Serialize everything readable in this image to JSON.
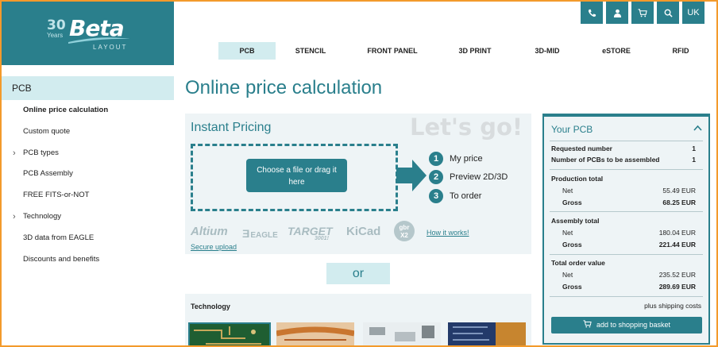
{
  "logo": {
    "years_number": "30",
    "years_label": "Years",
    "brand": "Beta",
    "sub": "LAYOUT"
  },
  "top_icons": [
    "phone-icon",
    "user-icon",
    "cart-icon",
    "search-icon"
  ],
  "language": "UK",
  "nav": [
    "PCB",
    "STENCIL",
    "FRONT PANEL",
    "3D PRINT",
    "3D-MID",
    "eSTORE",
    "RFID"
  ],
  "nav_active": "PCB",
  "sidebar": {
    "title": "PCB",
    "items": [
      {
        "label": "Online price calculation",
        "bold": true,
        "expandable": false
      },
      {
        "label": "Custom quote",
        "bold": false,
        "expandable": false
      },
      {
        "label": "PCB types",
        "bold": false,
        "expandable": true
      },
      {
        "label": "PCB Assembly",
        "bold": false,
        "expandable": false
      },
      {
        "label": "FREE FITS-or-NOT",
        "bold": false,
        "expandable": false
      },
      {
        "label": "Technology",
        "bold": false,
        "expandable": true
      },
      {
        "label": "3D data from EAGLE",
        "bold": false,
        "expandable": false
      },
      {
        "label": "Discounts and benefits",
        "bold": false,
        "expandable": false
      }
    ]
  },
  "page_title": "Online price calculation",
  "instant": {
    "title": "Instant Pricing",
    "tagline": "Let's go!",
    "upload_button": "Choose a file or drag it here",
    "steps": [
      {
        "num": "1",
        "label": "My price"
      },
      {
        "num": "2",
        "label": "Preview 2D/3D"
      },
      {
        "num": "3",
        "label": "To order"
      }
    ],
    "logos": [
      "Altium",
      "EAGLE",
      "TARGET",
      "3001!",
      "KiCad",
      "gbr",
      "X2"
    ],
    "how_it_works": "How it works!",
    "secure_upload": "Secure upload"
  },
  "or_label": "or",
  "technology": {
    "title": "Technology"
  },
  "your_pcb": {
    "title": "Your PCB",
    "requested_number_label": "Requested number",
    "requested_number": "1",
    "assembled_label": "Number of PCBs to be assembled",
    "assembled": "1",
    "production_total_label": "Production total",
    "production_net": "55.49 EUR",
    "production_gross": "68.25 EUR",
    "assembly_total_label": "Assembly total",
    "assembly_net": "180.04 EUR",
    "assembly_gross": "221.44 EUR",
    "order_total_label": "Total order value",
    "order_net": "235.52 EUR",
    "order_gross": "289.69 EUR",
    "net_label": "Net",
    "gross_label": "Gross",
    "shipping_note": "plus shipping costs",
    "basket_button": "add to shopping basket"
  },
  "colors": {
    "accent": "#2a7f8c",
    "accent_light": "#d2ecef",
    "panel": "#eef4f6",
    "frame": "#f39a2b"
  }
}
